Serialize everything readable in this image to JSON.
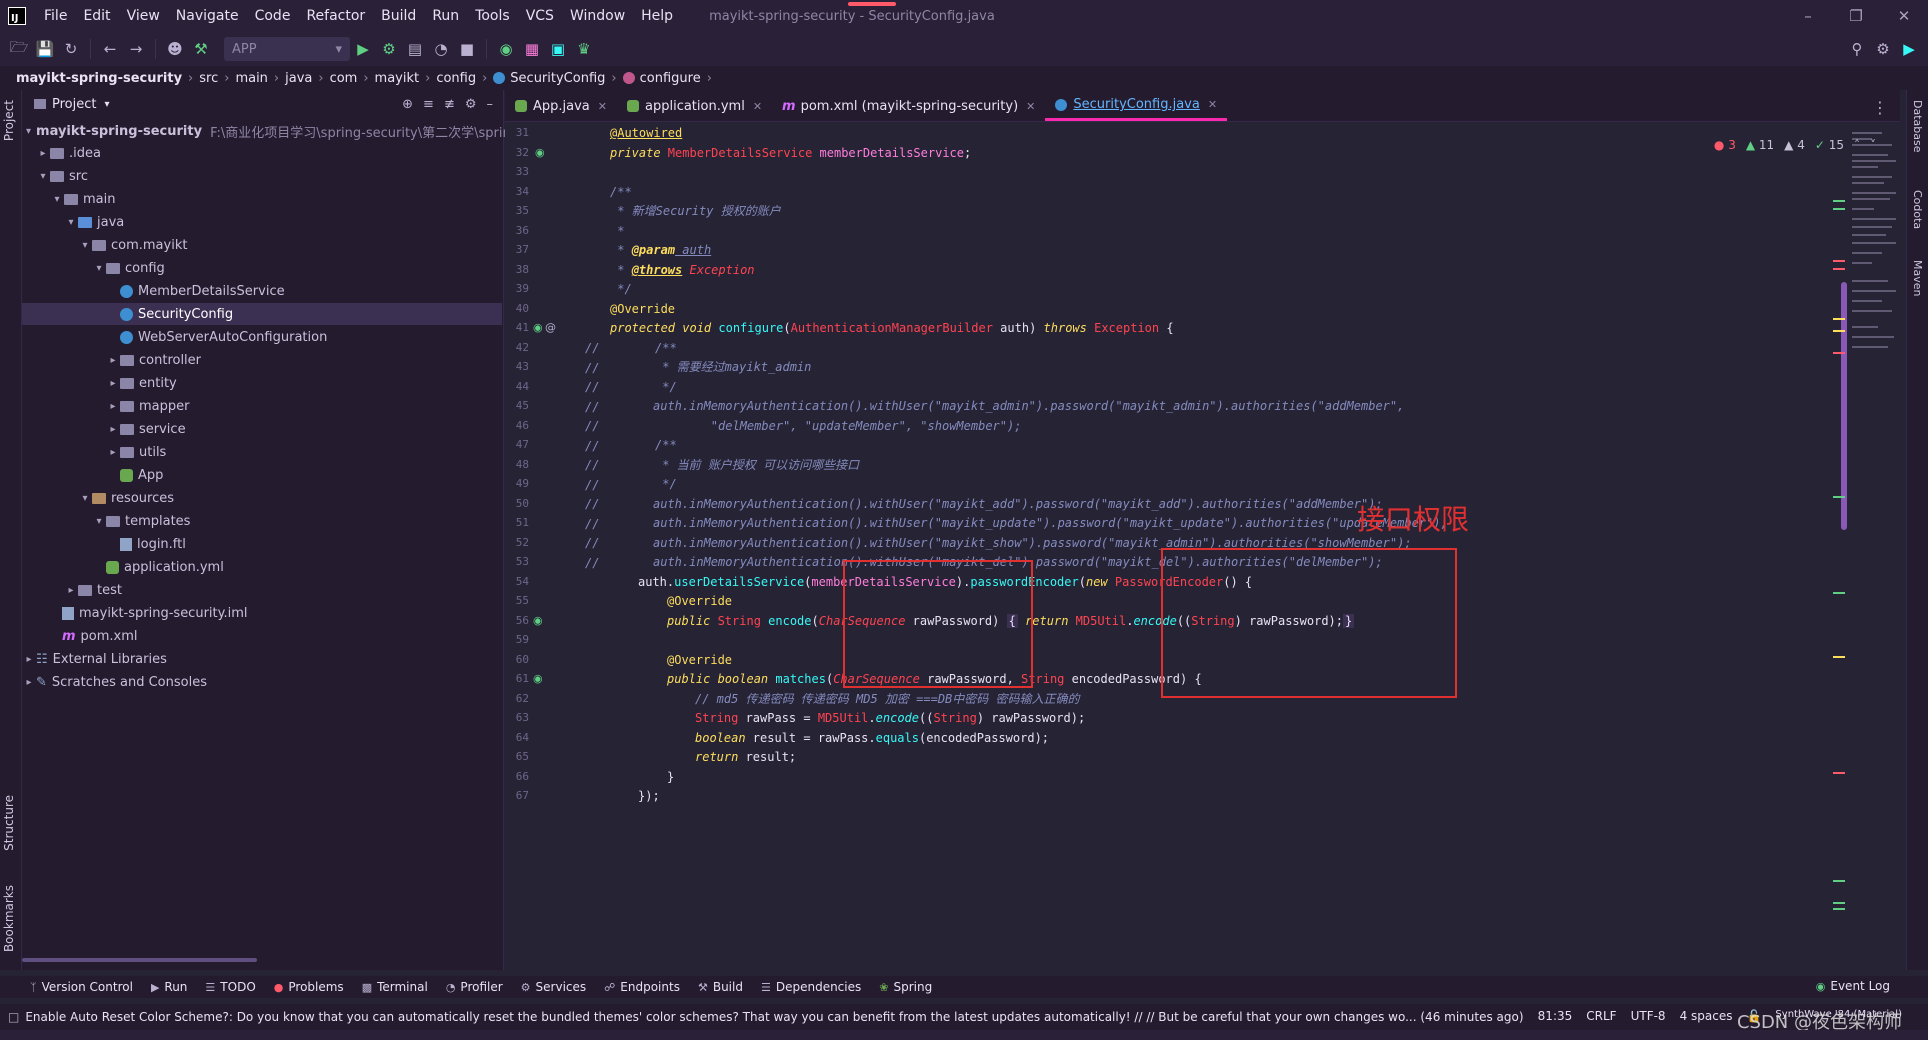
{
  "menu": {
    "items": [
      "File",
      "Edit",
      "View",
      "Navigate",
      "Code",
      "Refactor",
      "Build",
      "Run",
      "Tools",
      "VCS",
      "Window",
      "Help"
    ],
    "window_title": "mayikt-spring-security - SecurityConfig.java",
    "logo_text": "IJ"
  },
  "toolbar": {
    "run_config": "APP"
  },
  "breadcrumb": [
    "mayikt-spring-security",
    "src",
    "main",
    "java",
    "com",
    "mayikt",
    "config",
    "SecurityConfig",
    "configure"
  ],
  "project": {
    "header": "Project",
    "root_label": "mayikt-spring-security",
    "root_path": "F:\\商业化项目学习\\spring-security\\第二次学\\spring-s",
    "tree": [
      {
        "label": ".idea",
        "type": "folder"
      },
      {
        "label": "src",
        "type": "folder"
      },
      {
        "label": "main",
        "type": "folder"
      },
      {
        "label": "java",
        "type": "folder-blue"
      },
      {
        "label": "com.mayikt",
        "type": "folder"
      },
      {
        "label": "config",
        "type": "folder"
      },
      {
        "label": "MemberDetailsService",
        "type": "class"
      },
      {
        "label": "SecurityConfig",
        "type": "class"
      },
      {
        "label": "WebServerAutoConfiguration",
        "type": "class"
      },
      {
        "label": "controller",
        "type": "folder"
      },
      {
        "label": "entity",
        "type": "folder"
      },
      {
        "label": "mapper",
        "type": "folder"
      },
      {
        "label": "service",
        "type": "folder"
      },
      {
        "label": "utils",
        "type": "folder"
      },
      {
        "label": "App",
        "type": "spring"
      },
      {
        "label": "resources",
        "type": "folder-res"
      },
      {
        "label": "templates",
        "type": "folder"
      },
      {
        "label": "login.ftl",
        "type": "file"
      },
      {
        "label": "application.yml",
        "type": "spring"
      },
      {
        "label": "test",
        "type": "folder"
      },
      {
        "label": "mayikt-spring-security.iml",
        "type": "file"
      },
      {
        "label": "pom.xml",
        "type": "xml"
      },
      {
        "label": "External Libraries",
        "type": "lib"
      },
      {
        "label": "Scratches and Consoles",
        "type": "scratch"
      }
    ]
  },
  "tabs": [
    {
      "label": "App.java",
      "icon": "spring"
    },
    {
      "label": "application.yml",
      "icon": "spring"
    },
    {
      "label": "pom.xml (mayikt-spring-security)",
      "icon": "xml"
    },
    {
      "label": "SecurityConfig.java",
      "icon": "class"
    }
  ],
  "inspections": {
    "errors": "3",
    "warnings_a": "11",
    "warnings_b": "4",
    "ok": "15"
  },
  "code": {
    "line_numbers": [
      "31",
      "32",
      "33",
      "34",
      "35",
      "36",
      "37",
      "38",
      "39",
      "40",
      "41",
      "42",
      "43",
      "44",
      "45",
      "46",
      "47",
      "48",
      "49",
      "50",
      "51",
      "52",
      "53",
      "54",
      "55",
      "56",
      "59",
      "60",
      "61",
      "62",
      "63",
      "64",
      "65",
      "66",
      "67"
    ],
    "l31_ann": "@Autowired",
    "l32_kw": "private ",
    "l32_type": "MemberDetailsService ",
    "l32_var": "memberDetailsService",
    "l32_end": ";",
    "l34": "/**",
    "l35": " * 新增Security 授权的账户",
    "l36": " *",
    "l37_a": " * ",
    "l37_tag": "@param",
    "l37_b": " auth",
    "l38_a": " * ",
    "l38_tag": "@throws",
    "l38_b": " Exception",
    "l39": " */",
    "l40_ann": "@Override",
    "l41_kw": "protected void ",
    "l41_fn": "configure",
    "l41_p1": "(",
    "l41_type": "AuthenticationManagerBuilder ",
    "l41_arg": "auth",
    "l41_p2": ") ",
    "l41_throws": "throws ",
    "l41_exc": "Exception",
    "l41_end": " {",
    "l42": "/**",
    "l43": " * 需要经过mayikt_admin",
    "l44": " */",
    "l45": "auth.inMemoryAuthentication().withUser(\"mayikt_admin\").password(\"mayikt_admin\").authorities(\"addMember\",",
    "l46": "        \"delMember\", \"updateMember\", \"showMember\");",
    "l47": "/**",
    "l48": " * 当前 账户授权 可以访问哪些接口",
    "l49": " */",
    "l50": "auth.inMemoryAuthentication().withUser(\"mayikt_add\").password(\"mayikt_add\").authorities(\"addMember\");",
    "l51": "auth.inMemoryAuthentication().withUser(\"mayikt_update\").password(\"mayikt_update\").authorities(\"updateMember\");",
    "l52": "auth.inMemoryAuthentication().withUser(\"mayikt_show\").password(\"mayikt_admin\").authorities(\"showMember\");",
    "l53": "auth.inMemoryAuthentication().withUser(\"mayikt_del\").password(\"mayikt_del\").authorities(\"delMember\");",
    "l54_a": "auth.",
    "l54_fn": "userDetailsService",
    "l54_b": "(",
    "l54_var": "memberDetailsService",
    "l54_c": ").",
    "l54_fn2": "passwordEncoder",
    "l54_d": "(",
    "l54_new": "new ",
    "l54_type": "PasswordEncoder",
    "l54_e": "() {",
    "l55_ann": "@Override",
    "l56_kw": "public ",
    "l56_type": "String ",
    "l56_fn": "encode",
    "l56_a": "(",
    "l56_ptype": "CharSequence ",
    "l56_arg": "rawPassword",
    "l56_b": ") ",
    "l56_brace": "{",
    "l56_ret": " return ",
    "l56_util": "MD5Util",
    "l56_c": ".",
    "l56_fn2": "encode",
    "l56_d": "((",
    "l56_str": "String",
    "l56_e": ") rawPassword);",
    "l56_end": "}",
    "l60_ann": "@Override",
    "l61_kw": "public boolean ",
    "l61_fn": "matches",
    "l61_a": "(",
    "l61_ptype": "CharSequence ",
    "l61_arg": "rawPassword",
    "l61_b": ", ",
    "l61_type2": "String ",
    "l61_arg2": "encodedPassword",
    "l61_c": ") {",
    "l62": "// md5 传递密码 传递密码 MD5 加密 ===DB中密码 密码输入正确的",
    "l63_type": "String ",
    "l63_a": "rawPass = ",
    "l63_util": "MD5Util",
    "l63_b": ".",
    "l63_fn": "encode",
    "l63_c": "((",
    "l63_str": "String",
    "l63_d": ") rawPassword);",
    "l64_kw": "boolean ",
    "l64_a": "result = rawPass.",
    "l64_fn": "equals",
    "l64_b": "(encodedPassword);",
    "l65_kw": "return ",
    "l65_a": "result;",
    "l66": "}",
    "l67": "});",
    "comment_slash": "//"
  },
  "annotation": {
    "label": "接口权限"
  },
  "bottom_tools": [
    "Version Control",
    "Run",
    "TODO",
    "Problems",
    "Terminal",
    "Profiler",
    "Services",
    "Endpoints",
    "Build",
    "Dependencies",
    "Spring"
  ],
  "event_log": "Event Log",
  "status": {
    "message": "Enable Auto Reset Color Scheme?: Do you know that you can automatically reset the bundled themes' color schemes? That way you can benefit from the latest updates automatically! // // But be careful that your own changes wo... (46 minutes ago)",
    "position": "81:35",
    "line_sep": "CRLF",
    "encoding": "UTF-8",
    "indent": "4 spaces",
    "theme": "SynthWave '84 (Material)"
  },
  "side_labels": {
    "project": "Project",
    "structure": "Structure",
    "bookmarks": "Bookmarks",
    "database": "Database",
    "codota": "Codota",
    "maven": "Maven"
  },
  "watermark": "CSDN @夜色架构师"
}
